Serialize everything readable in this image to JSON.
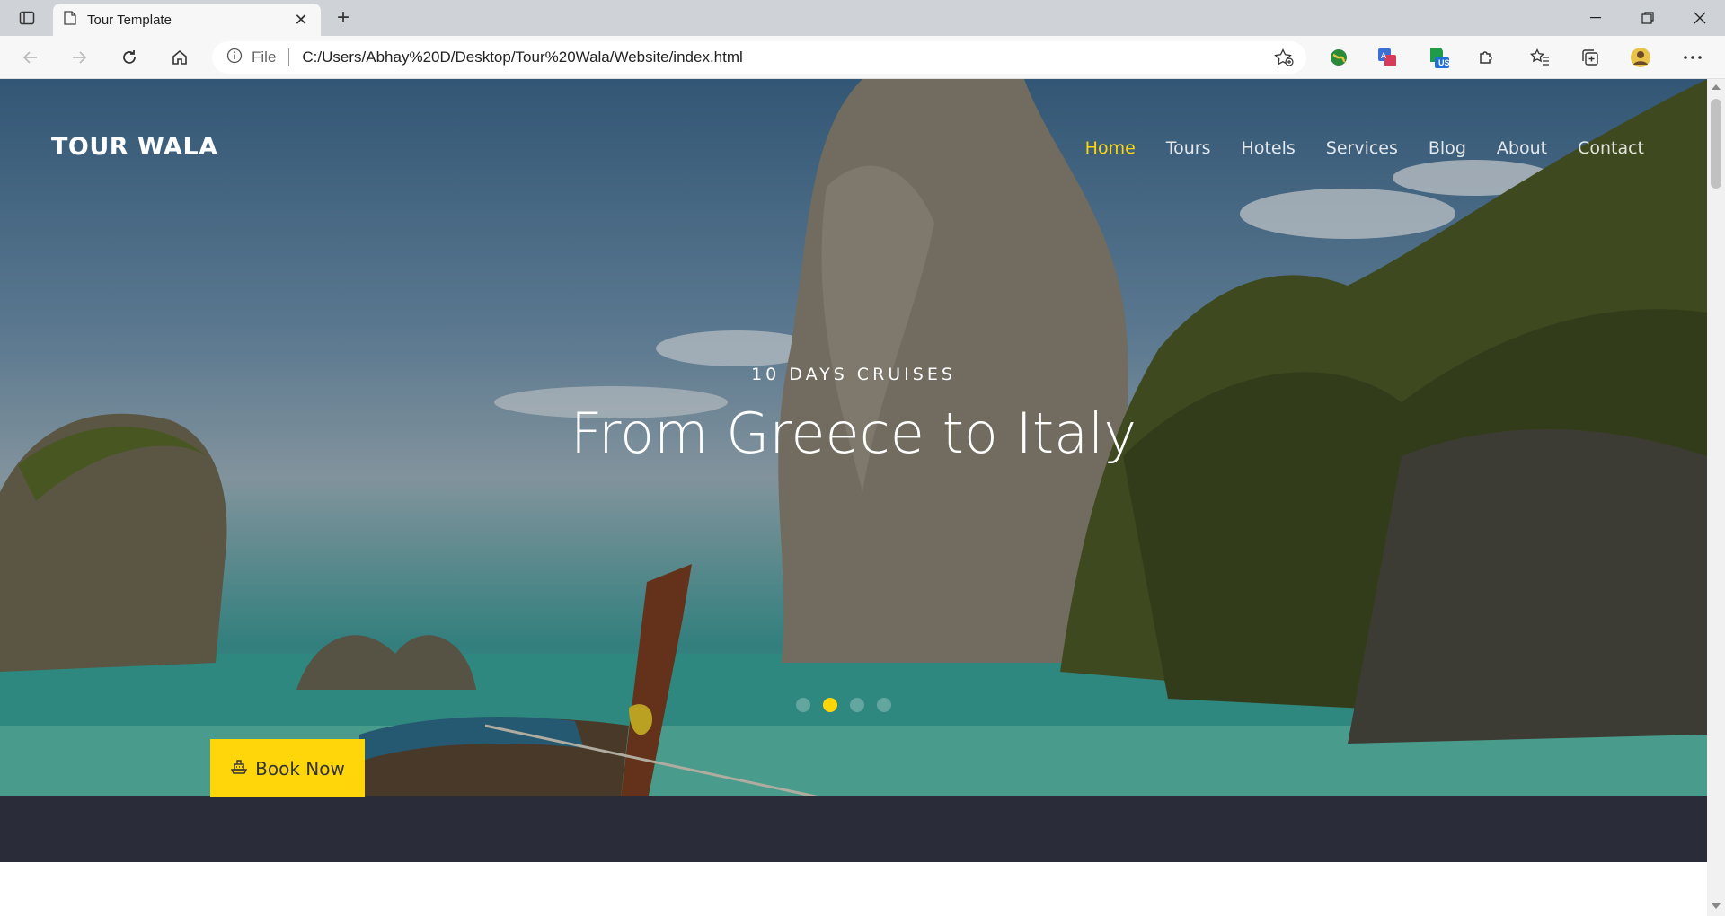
{
  "browser": {
    "tab_title": "Tour Template",
    "address_label": "File",
    "url": "C:/Users/Abhay%20D/Desktop/Tour%20Wala/Website/index.html",
    "extension_badge": "US"
  },
  "site": {
    "brand": "TOUR WALA",
    "nav": [
      {
        "label": "Home",
        "active": true
      },
      {
        "label": "Tours"
      },
      {
        "label": "Hotels"
      },
      {
        "label": "Services"
      },
      {
        "label": "Blog"
      },
      {
        "label": "About"
      },
      {
        "label": "Contact"
      }
    ],
    "hero": {
      "subtitle": "10 DAYS CRUISES",
      "headline": "From Greece to Italy",
      "slide_count": 4,
      "active_slide": 2,
      "cta_label": "Book Now"
    },
    "colors": {
      "accent": "#ffd60a",
      "dark_band": "#2b2c3a"
    }
  }
}
